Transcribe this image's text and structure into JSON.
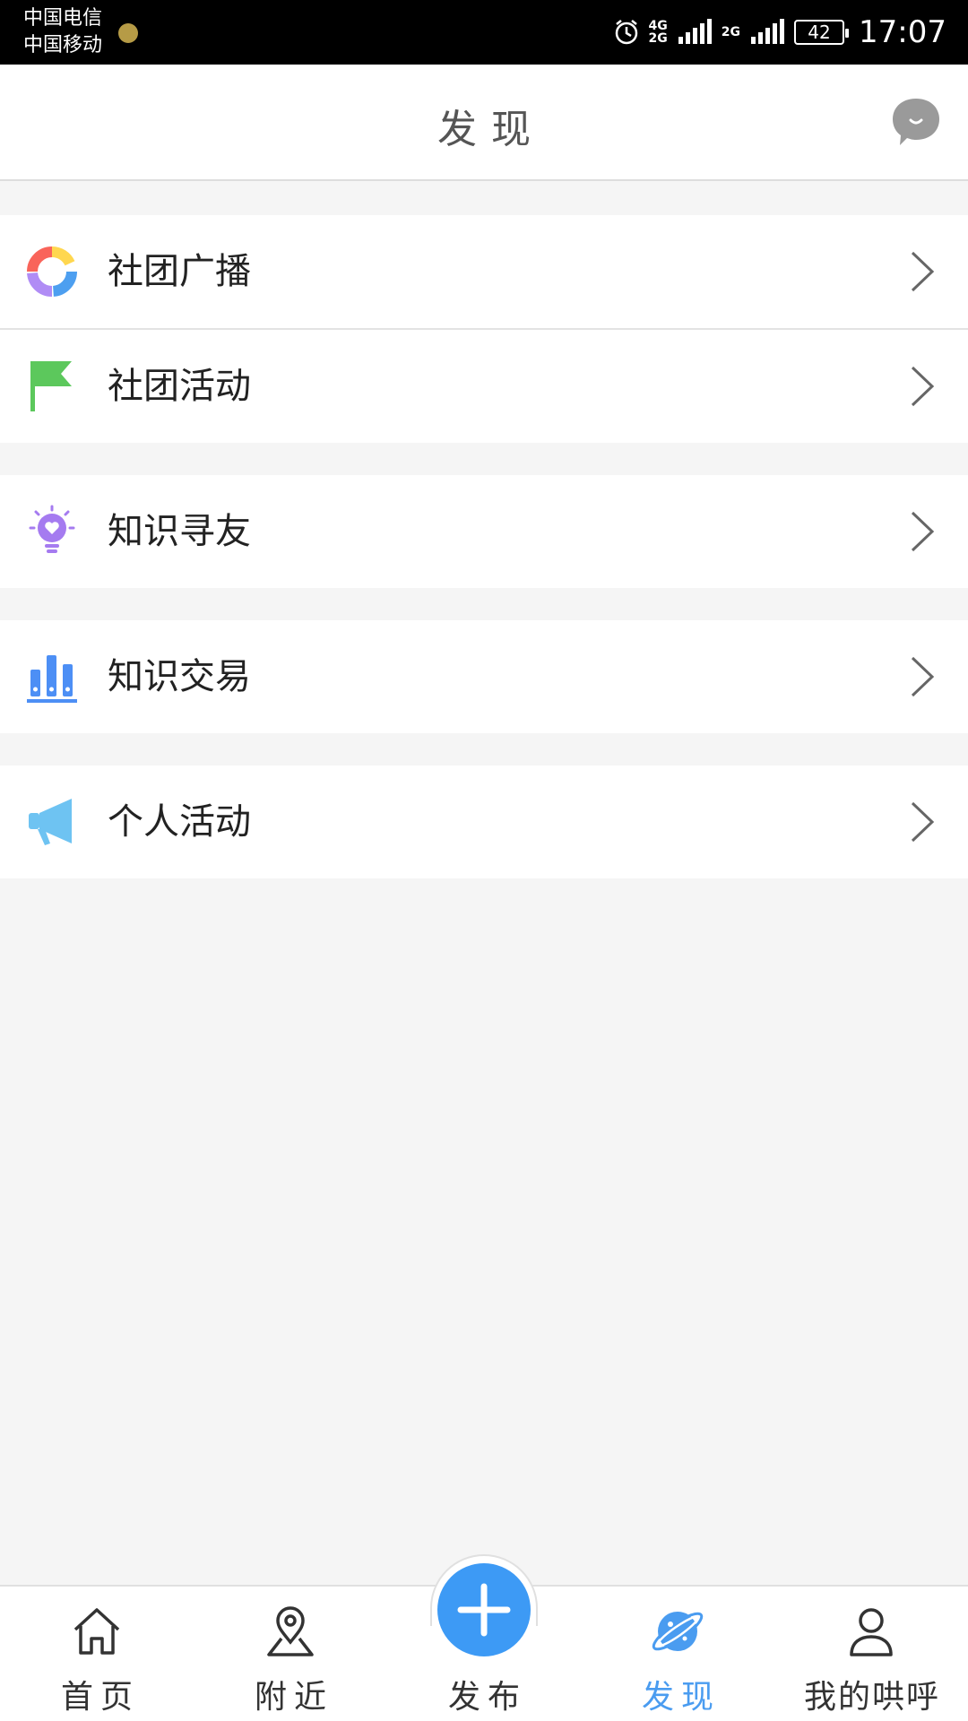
{
  "status_bar": {
    "carrier_1": "中国电信",
    "carrier_2": "中国移动",
    "network_1": "4G",
    "network_2": "2G",
    "network_3": "2G",
    "battery": "42",
    "time": "17:07"
  },
  "header": {
    "title": "发现",
    "chat_icon": "chat-bubble-icon"
  },
  "menu": {
    "items": [
      {
        "label": "社团广播",
        "icon": "donut-chart-icon"
      },
      {
        "label": "社团活动",
        "icon": "flag-icon"
      },
      {
        "label": "知识寻友",
        "icon": "lightbulb-heart-icon"
      },
      {
        "label": "知识交易",
        "icon": "bar-chart-icon"
      },
      {
        "label": "个人活动",
        "icon": "megaphone-icon"
      }
    ]
  },
  "bottom_nav": {
    "items": [
      {
        "label": "首页",
        "icon": "home-icon",
        "active": false
      },
      {
        "label": "附近",
        "icon": "location-pin-icon",
        "active": false
      },
      {
        "label": "发布",
        "icon": "plus-icon",
        "active": false
      },
      {
        "label": "发现",
        "icon": "planet-icon",
        "active": true
      },
      {
        "label": "我的哄呼",
        "icon": "person-icon",
        "active": false
      }
    ]
  },
  "colors": {
    "accent": "#4a9cf0",
    "publish_button": "#3d9af5",
    "flag_green": "#5cc85c",
    "megaphone_blue": "#6ec3f2",
    "bulb_purple": "#a57bf0",
    "barchart_blue": "#4d8ff5"
  }
}
